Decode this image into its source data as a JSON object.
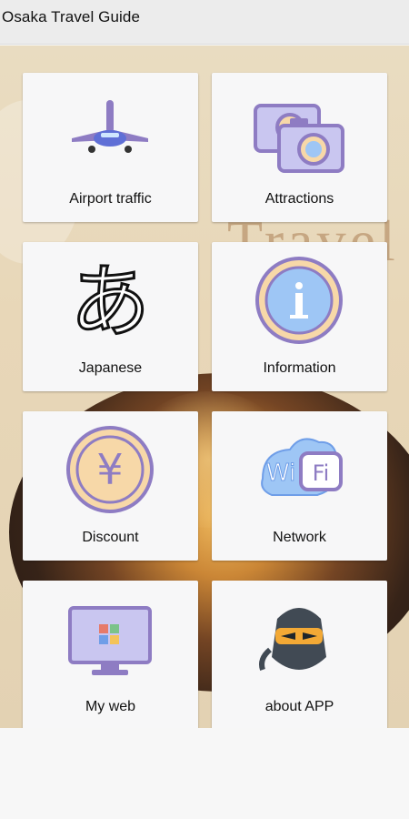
{
  "app": {
    "title": "Osaka Travel Guide"
  },
  "background": {
    "decor_text": "Travel"
  },
  "tiles": [
    {
      "label": "Airport traffic",
      "icon": "airplane-icon"
    },
    {
      "label": "Attractions",
      "icon": "camera-icon"
    },
    {
      "label": "Japanese",
      "icon": "hiragana-a-icon"
    },
    {
      "label": "Information",
      "icon": "info-icon"
    },
    {
      "label": "Discount",
      "icon": "yen-coin-icon"
    },
    {
      "label": "Network",
      "icon": "wifi-icon"
    },
    {
      "label": "My web",
      "icon": "monitor-icon"
    },
    {
      "label": "about APP",
      "icon": "ninja-icon"
    }
  ],
  "colors": {
    "accent_purple": "#8e7cc3",
    "accent_blue": "#6f9ee8",
    "accent_peach": "#f7d8a8"
  }
}
